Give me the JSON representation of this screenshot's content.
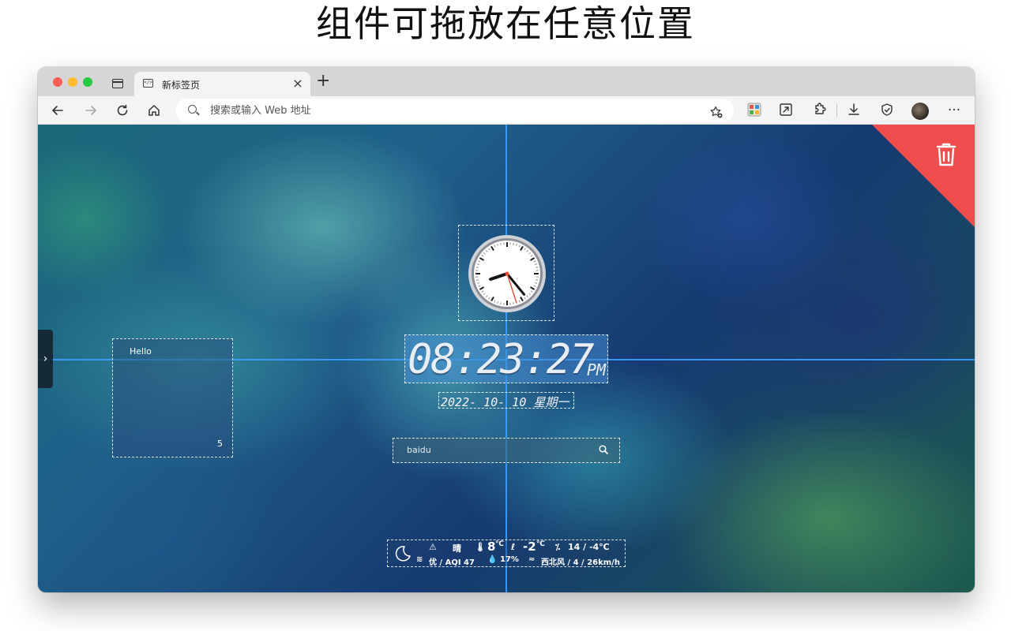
{
  "headline": "组件可拖放在任意位置",
  "browser": {
    "tab": {
      "favicon": "</>",
      "title": "新标签页",
      "close": "×"
    },
    "new_tab": "+",
    "address": {
      "placeholder": "搜索或输入 Web 地址",
      "value": ""
    },
    "toolbar_icons": [
      "back-icon",
      "forward-icon",
      "reload-icon",
      "home-icon",
      "favorite-star-icon",
      "extension-grid-icon",
      "expand-icon",
      "puzzle-icon",
      "download-icon",
      "shield-icon",
      "avatar",
      "more-icon"
    ],
    "more": "···"
  },
  "newtab": {
    "sidebar_handle": "›",
    "note": {
      "title": "Hello",
      "count": "5"
    },
    "digital_clock": {
      "time": "08:23:27",
      "ampm": "PM"
    },
    "date": {
      "text": "2022- 10- 10 星期一"
    },
    "search": {
      "placeholder": "baidu"
    },
    "weather": {
      "condition": "晴",
      "temp": "8",
      "temp_unit": "℃",
      "feels": "-2",
      "feels_unit": "℃",
      "range": "14 / -4℃",
      "aqi": "优 / AQI 47",
      "humidity": "17%",
      "wind": "西北风 / 4 / 26km/h"
    },
    "clock": {
      "hours": 8,
      "minutes": 23,
      "seconds": 27
    },
    "colors": {
      "guide": "#3aa0ff",
      "trash": "#f04e4e"
    }
  }
}
